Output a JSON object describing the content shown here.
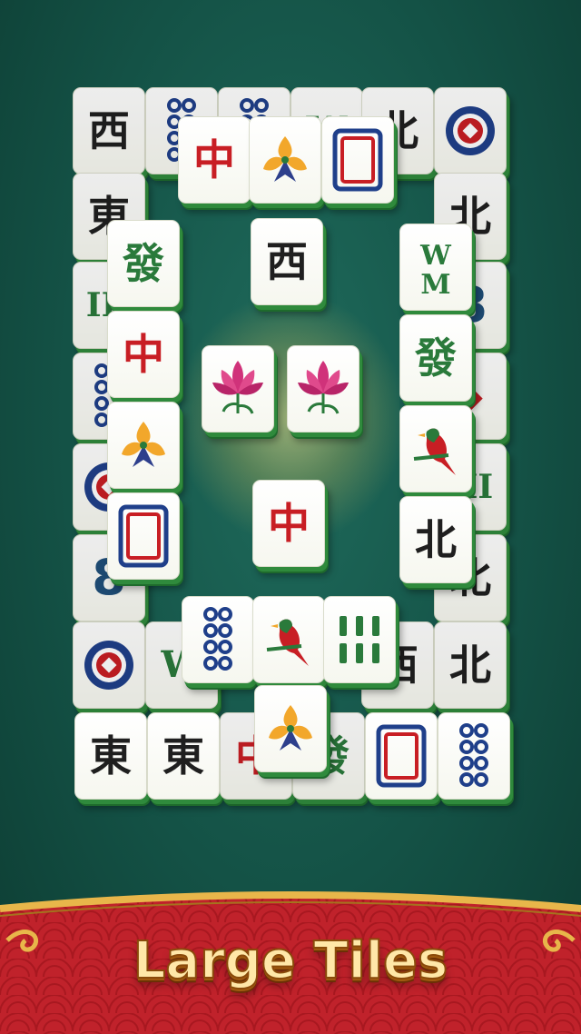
{
  "banner": {
    "title": "Large Tiles"
  },
  "colors": {
    "background": "#145246",
    "tile_face": "#ffffff",
    "tile_edge": "#2f8a3c",
    "banner_red": "#c0222b",
    "banner_gold": "#e8b64a",
    "text_gold": "#ffe7a8"
  },
  "board": {
    "layer0": [
      {
        "glyph": "西",
        "color": "black"
      },
      {
        "icon": "circles-8"
      },
      {
        "icon": "circles-8"
      },
      {
        "icon": "bamboo-W"
      },
      {
        "glyph": "北",
        "color": "black"
      },
      {
        "icon": "circle-coin"
      },
      {
        "glyph": "東",
        "color": "black"
      },
      {
        "glyph": "北",
        "color": "black"
      },
      {
        "icon": "bamboo-3"
      },
      {
        "icon": "circles-8"
      },
      {
        "icon": "circles-8"
      },
      {
        "icon": "coin"
      },
      {
        "icon": "circle-coin"
      },
      {
        "icon": "bamboo-3"
      },
      {
        "icon": "char-8"
      },
      {
        "glyph": "北",
        "color": "black"
      },
      {
        "icon": "circle-coin"
      },
      {
        "icon": "bamboo-W"
      },
      {
        "glyph": "西",
        "color": "black"
      },
      {
        "glyph": "北",
        "color": "black"
      },
      {
        "glyph": "東",
        "color": "black"
      },
      {
        "glyph": "東",
        "color": "black"
      },
      {
        "glyph": "中",
        "color": "red"
      },
      {
        "glyph": "發",
        "color": "green"
      },
      {
        "icon": "frame"
      },
      {
        "icon": "circles-8"
      }
    ],
    "layer1": [
      {
        "glyph": "中",
        "color": "red"
      },
      {
        "icon": "orchid"
      },
      {
        "icon": "frame"
      },
      {
        "glyph": "西",
        "color": "black"
      },
      {
        "glyph": "發",
        "color": "green"
      },
      {
        "glyph": "中",
        "color": "red"
      },
      {
        "icon": "orchid"
      },
      {
        "icon": "frame"
      },
      {
        "icon": "bamboo-W"
      },
      {
        "glyph": "發",
        "color": "green"
      },
      {
        "icon": "bird"
      },
      {
        "glyph": "北",
        "color": "black"
      },
      {
        "icon": "lotus"
      },
      {
        "icon": "lotus"
      },
      {
        "glyph": "中",
        "color": "red"
      },
      {
        "icon": "circles-8"
      },
      {
        "icon": "bird"
      },
      {
        "icon": "bamboo-3"
      },
      {
        "icon": "orchid"
      }
    ]
  }
}
